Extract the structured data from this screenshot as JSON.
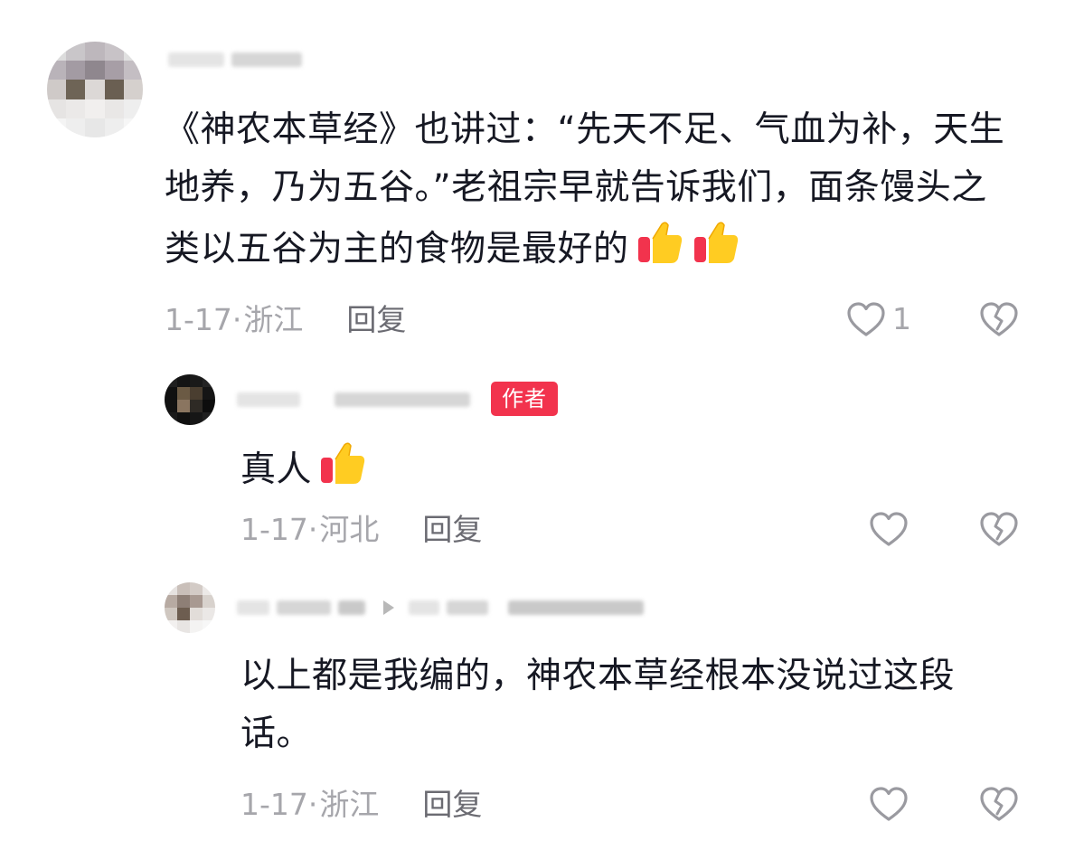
{
  "comments": [
    {
      "text": "《神农本草经》也讲过：“先天不足、气血为补，天生地养，乃为五谷。”老祖宗早就告诉我们，面条馒头之类以五谷为主的食物是最好的",
      "emoji": [
        "thumbs-up",
        "thumbs-up"
      ],
      "date": "1-17·",
      "location": "浙江",
      "reply_label": "回复",
      "like_count": "1"
    },
    {
      "badge": "作者",
      "text": "真人",
      "emoji": [
        "thumbs-up"
      ],
      "date": "1-17·",
      "location": "河北",
      "reply_label": "回复",
      "like_count": ""
    },
    {
      "text": "以上都是我编的，神农本草经根本没说过这段话。",
      "date": "1-17·",
      "location": "浙江",
      "reply_label": "回复",
      "like_count": ""
    }
  ],
  "icons": {
    "like": "heart-outline-icon",
    "dislike": "broken-heart-icon",
    "reply_arrow": "reply-arrow-icon"
  },
  "colors": {
    "text": "#161823",
    "meta": "#a6a6ab",
    "reply": "#6b6b72",
    "badge": "#f2334d"
  }
}
